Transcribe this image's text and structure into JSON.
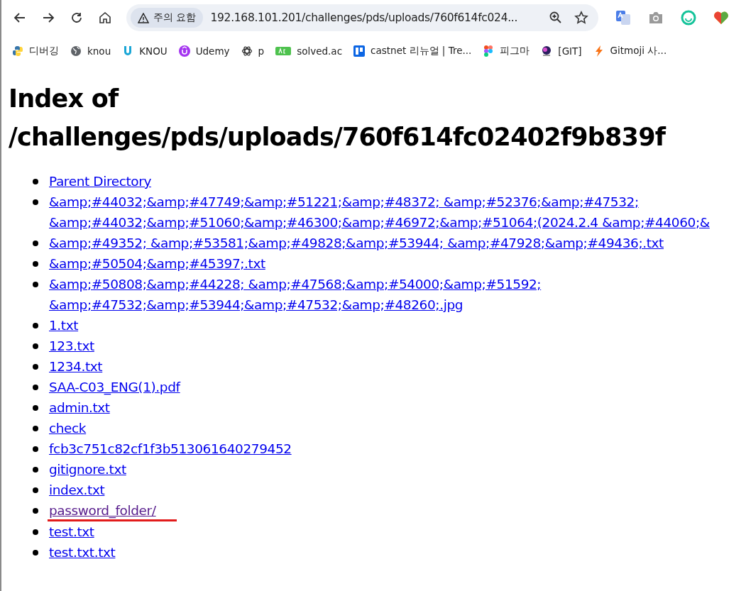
{
  "toolbar": {
    "security_chip": "주의 요함",
    "url": "192.168.101.201/challenges/pds/uploads/760f614fc024..."
  },
  "bookmarks": [
    {
      "label": "디버깅",
      "kind": "python"
    },
    {
      "label": "knou",
      "kind": "globe"
    },
    {
      "label": "KNOU",
      "kind": "u"
    },
    {
      "label": "Udemy",
      "kind": "udemy"
    },
    {
      "label": "p",
      "kind": "knot"
    },
    {
      "label": "solved.ac",
      "kind": "ac"
    },
    {
      "label": "castnet 리뉴얼 | Tre...",
      "kind": "trello"
    },
    {
      "label": "피그마",
      "kind": "figma"
    },
    {
      "label": "[GIT]",
      "kind": "orb"
    },
    {
      "label": "Gitmoji 사...",
      "kind": "bolt"
    }
  ],
  "heading": [
    "Index of",
    "/challenges/pds/uploads/760f614fc02402f9b839f"
  ],
  "items": [
    {
      "lines": [
        "Parent Directory"
      ],
      "visited": false,
      "marked": false
    },
    {
      "lines": [
        "&amp;#44032;&amp;#47749;&amp;#51221;&amp;#48372; &amp;#52376;&amp;#47532;",
        "&amp;#44032;&amp;#51060;&amp;#46300;&amp;#46972;&amp;#51064;(2024.2.4 &amp;#44060;&"
      ],
      "visited": false,
      "marked": false
    },
    {
      "lines": [
        "&amp;#49352; &amp;#53581;&amp;#49828;&amp;#53944; &amp;#47928;&amp;#49436;.txt"
      ],
      "visited": false,
      "marked": false
    },
    {
      "lines": [
        "&amp;#50504;&amp;#45397;.txt"
      ],
      "visited": false,
      "marked": false
    },
    {
      "lines": [
        "&amp;#50808;&amp;#44228; &amp;#47568;&amp;#54000;&amp;#51592;",
        "&amp;#47532;&amp;#53944;&amp;#47532;&amp;#48260;.jpg"
      ],
      "visited": false,
      "marked": false
    },
    {
      "lines": [
        "1.txt"
      ],
      "visited": false,
      "marked": false
    },
    {
      "lines": [
        "123.txt"
      ],
      "visited": false,
      "marked": false
    },
    {
      "lines": [
        "1234.txt"
      ],
      "visited": false,
      "marked": false
    },
    {
      "lines": [
        "SAA-C03_ENG(1).pdf"
      ],
      "visited": false,
      "marked": false
    },
    {
      "lines": [
        "admin.txt"
      ],
      "visited": false,
      "marked": false
    },
    {
      "lines": [
        "check"
      ],
      "visited": false,
      "marked": false
    },
    {
      "lines": [
        "fcb3c751c82cf1f3b513061640279452"
      ],
      "visited": false,
      "marked": false
    },
    {
      "lines": [
        "gitignore.txt"
      ],
      "visited": false,
      "marked": false
    },
    {
      "lines": [
        "index.txt"
      ],
      "visited": false,
      "marked": false
    },
    {
      "lines": [
        "password_folder/"
      ],
      "visited": true,
      "marked": true
    },
    {
      "lines": [
        "test.txt"
      ],
      "visited": false,
      "marked": false
    },
    {
      "lines": [
        "test.txt.txt"
      ],
      "visited": false,
      "marked": false
    }
  ]
}
